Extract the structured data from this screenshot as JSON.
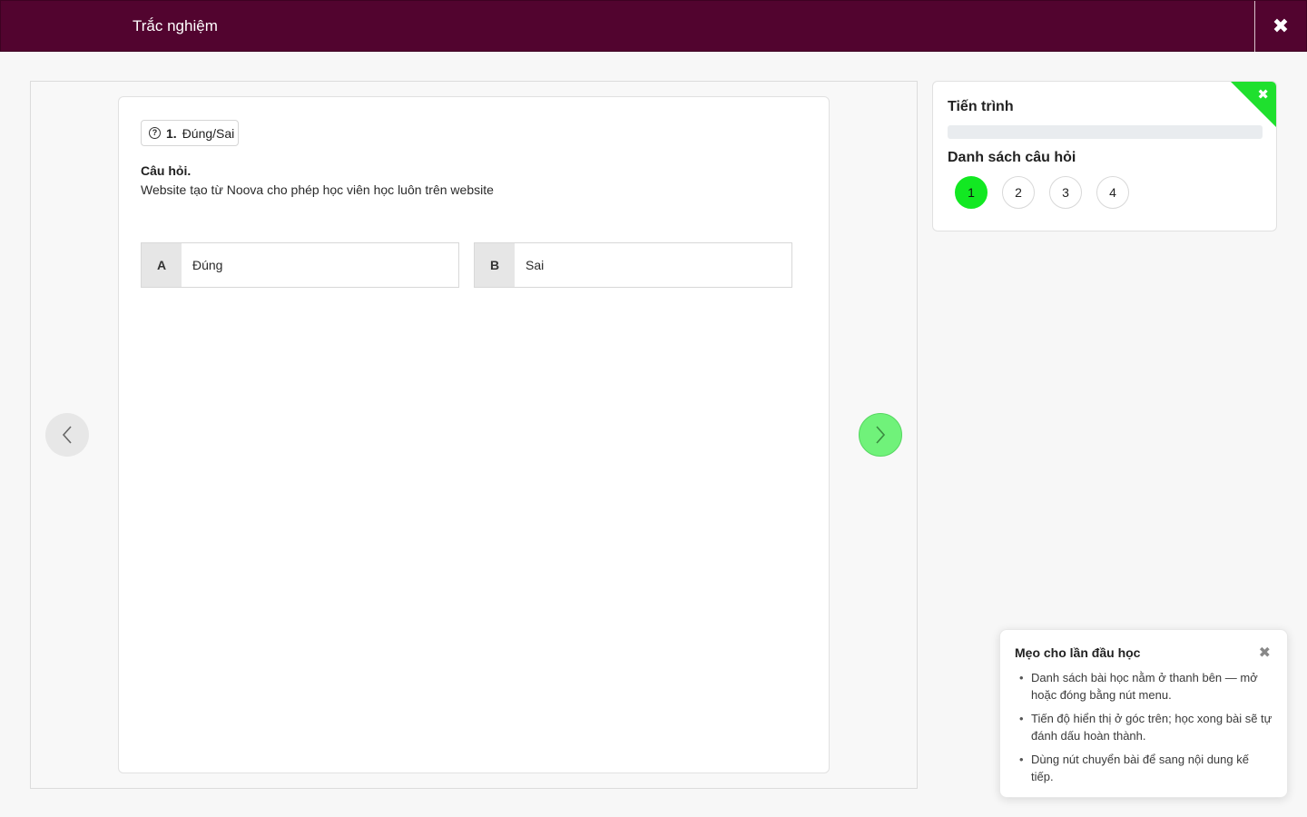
{
  "header": {
    "title": "Trắc nghiệm",
    "close_label": "✖"
  },
  "question": {
    "number": "1.",
    "type": "Đúng/Sai",
    "label": "Câu hỏi.",
    "text": "Website tạo từ Noova cho phép học viên học luôn trên website",
    "options": [
      {
        "letter": "A",
        "text": "Đúng"
      },
      {
        "letter": "B",
        "text": "Sai"
      }
    ]
  },
  "progress": {
    "title": "Tiến trình",
    "value": 0,
    "list_title": "Danh sách câu hỏi",
    "questions": [
      "1",
      "2",
      "3",
      "4"
    ],
    "active_index": 0,
    "accent_color": "#1fe02e"
  },
  "tips": {
    "title": "Mẹo cho lần đầu học",
    "items": [
      "Danh sách bài học nằm ở thanh bên — mở hoặc đóng bằng nút menu.",
      "Tiến độ hiển thị ở góc trên; học xong bài sẽ tự đánh dấu hoàn thành.",
      "Dùng nút chuyển bài để sang nội dung kế tiếp."
    ]
  },
  "colors": {
    "header_bg": "#52042f",
    "next_button": "#70f27a",
    "active_question": "#12e822"
  }
}
